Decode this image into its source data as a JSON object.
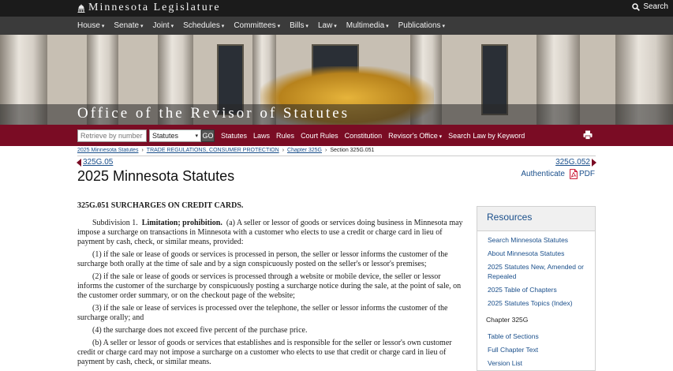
{
  "header": {
    "logo_text": "Minnesota Legislature",
    "search_label": "Search"
  },
  "nav": {
    "items": [
      {
        "label": "House"
      },
      {
        "label": "Senate"
      },
      {
        "label": "Joint"
      },
      {
        "label": "Schedules"
      },
      {
        "label": "Committees"
      },
      {
        "label": "Bills"
      },
      {
        "label": "Law"
      },
      {
        "label": "Multimedia"
      },
      {
        "label": "Publications"
      }
    ]
  },
  "hero": {
    "title": "Office of the Revisor of Statutes"
  },
  "toolbar": {
    "retrieve_placeholder": "Retrieve by number",
    "select_value": "Statutes",
    "go_label": "GO",
    "links": [
      {
        "label": "Statutes"
      },
      {
        "label": "Laws"
      },
      {
        "label": "Rules"
      },
      {
        "label": "Court Rules"
      },
      {
        "label": "Constitution"
      },
      {
        "label": "Revisor's Office"
      },
      {
        "label": "Search Law by Keyword"
      }
    ]
  },
  "breadcrumb": {
    "items": [
      {
        "label": "2025 Minnesota Statutes"
      },
      {
        "label": "TRADE REGULATIONS, CONSUMER PROTECTION"
      },
      {
        "label": "Chapter 325G"
      },
      {
        "label": "Section 325G.051"
      }
    ]
  },
  "pager": {
    "prev": "325G.05",
    "next": "325G.052"
  },
  "page": {
    "title": "2025 Minnesota Statutes",
    "authenticate": "Authenticate",
    "pdf": "PDF"
  },
  "statute": {
    "heading": "325G.051 SURCHARGES ON CREDIT CARDS.",
    "subd_number": "Subdivision 1.",
    "subd_title": "Limitation; prohibition.",
    "subd_text": "(a) A seller or lessor of goods or services doing business in Minnesota may impose a surcharge on transactions in Minnesota with a customer who elects to use a credit or charge card in lieu of payment by cash, check, or similar means, provided:",
    "clauses": [
      "(1) if the sale or lease of goods or services is processed in person, the seller or lessor informs the customer of the surcharge both orally at the time of sale and by a sign conspicuously posted on the seller's or lessor's premises;",
      "(2) if the sale or lease of goods or services is processed through a website or mobile device, the seller or lessor informs the customer of the surcharge by conspicuously posting a surcharge notice during the sale, at the point of sale, on the customer order summary, or on the checkout page of the website;",
      "(3) if the sale or lease of services is processed over the telephone, the seller or lessor informs the customer of the surcharge orally; and",
      "(4) the surcharge does not exceed five percent of the purchase price.",
      "(b) A seller or lessor of goods or services that establishes and is responsible for the seller or lessor's own customer credit or charge card may not impose a surcharge on a customer who elects to use that credit or charge card in lieu of payment by cash, check, or similar means."
    ]
  },
  "resources": {
    "heading": "Resources",
    "links": [
      {
        "label": "Search Minnesota Statutes"
      },
      {
        "label": "About Minnesota Statutes"
      },
      {
        "label": "2025 Statutes New, Amended or Repealed"
      },
      {
        "label": "2025 Table of Chapters"
      },
      {
        "label": "2025 Statutes Topics (Index)"
      }
    ],
    "chapter_heading": "Chapter 325G",
    "chapter_links": [
      {
        "label": "Table of Sections"
      },
      {
        "label": "Full Chapter Text"
      },
      {
        "label": "Version List"
      }
    ]
  },
  "colors": {
    "maroon": "#7a0c24",
    "link": "#1a4f8b",
    "topbar": "#1b1b1b",
    "navbar": "#3b3b3b"
  }
}
